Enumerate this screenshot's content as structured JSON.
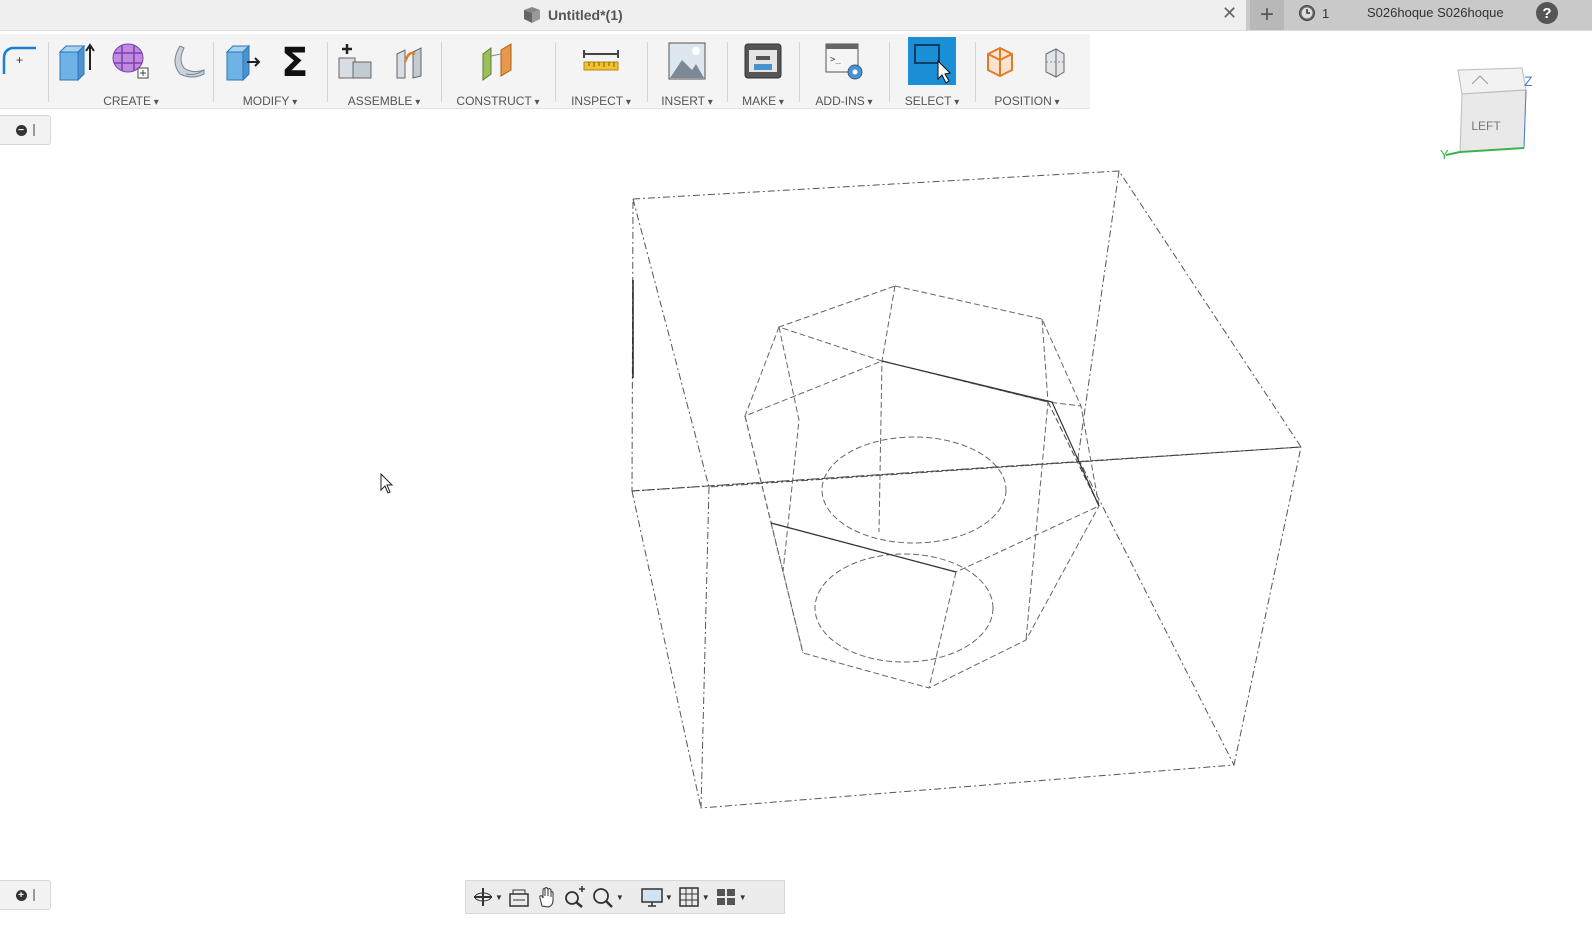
{
  "titlebar": {
    "doc_title": "Untitled*(1)",
    "jobs_count": "1",
    "user_name": "S026hoque S026hoque",
    "help_label": "?"
  },
  "toolbar": {
    "groups": [
      {
        "label": "CREATE"
      },
      {
        "label": "MODIFY"
      },
      {
        "label": "ASSEMBLE"
      },
      {
        "label": "CONSTRUCT"
      },
      {
        "label": "INSPECT"
      },
      {
        "label": "INSERT"
      },
      {
        "label": "MAKE"
      },
      {
        "label": "ADD-INS"
      },
      {
        "label": "SELECT"
      },
      {
        "label": "POSITION"
      }
    ]
  },
  "viewcube": {
    "face_label": "LEFT",
    "axis_z": "Z",
    "axis_y": "Y"
  },
  "colors": {
    "select_active": "#1a8fd6",
    "titlebar": "#efefef",
    "toolbar": "#f4f4f4"
  },
  "icons": [
    "sketch-icon",
    "extrude-box-icon",
    "form-grid-icon",
    "revolve-icon",
    "press-pull-icon",
    "sigma-icon",
    "new-component-icon",
    "joint-icon",
    "construct-plane-icon",
    "measure-ruler-icon",
    "insert-image-icon",
    "3d-print-icon",
    "scripts-addins-icon",
    "select-window-icon",
    "move-icon",
    "align-icon",
    "orbit-icon",
    "look-at-icon",
    "pan-icon",
    "zoom-icon",
    "fit-icon",
    "display-settings-icon",
    "grid-icon",
    "viewports-icon"
  ]
}
